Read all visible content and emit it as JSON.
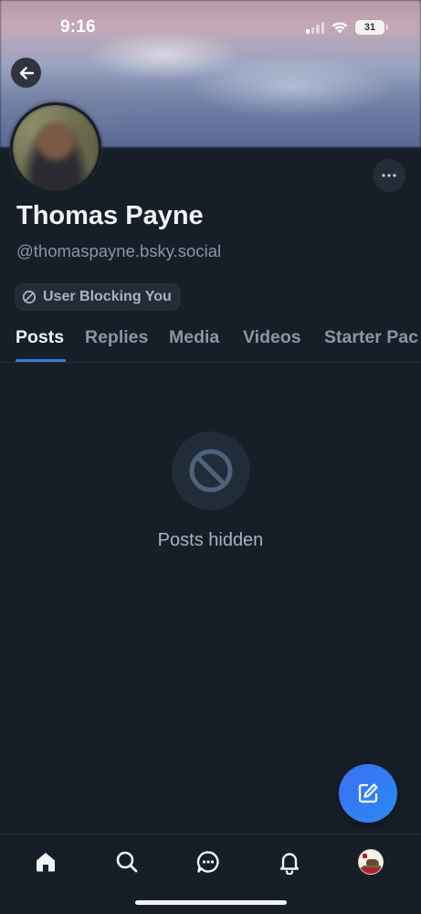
{
  "status_bar": {
    "time": "9:16",
    "battery": "31"
  },
  "profile": {
    "display_name": "Thomas Payne",
    "handle": "@thomaspayne.bsky.social",
    "block_badge": "User Blocking You"
  },
  "tabs": [
    {
      "label": "Posts",
      "active": true
    },
    {
      "label": "Replies",
      "active": false
    },
    {
      "label": "Media",
      "active": false
    },
    {
      "label": "Videos",
      "active": false
    },
    {
      "label": "Starter Pac",
      "active": false
    }
  ],
  "empty_state": {
    "text": "Posts hidden",
    "icon": "block-icon"
  },
  "bottom_nav": [
    {
      "name": "home",
      "icon": "home-icon",
      "active": true
    },
    {
      "name": "search",
      "icon": "search-icon"
    },
    {
      "name": "messages",
      "icon": "chat-icon"
    },
    {
      "name": "notifications",
      "icon": "bell-icon"
    },
    {
      "name": "profile",
      "icon": "avatar-icon"
    }
  ],
  "colors": {
    "background": "#161e27",
    "accent": "#2d82e8",
    "fab": "#3d6ef7",
    "muted_text": "#8a96a6"
  }
}
